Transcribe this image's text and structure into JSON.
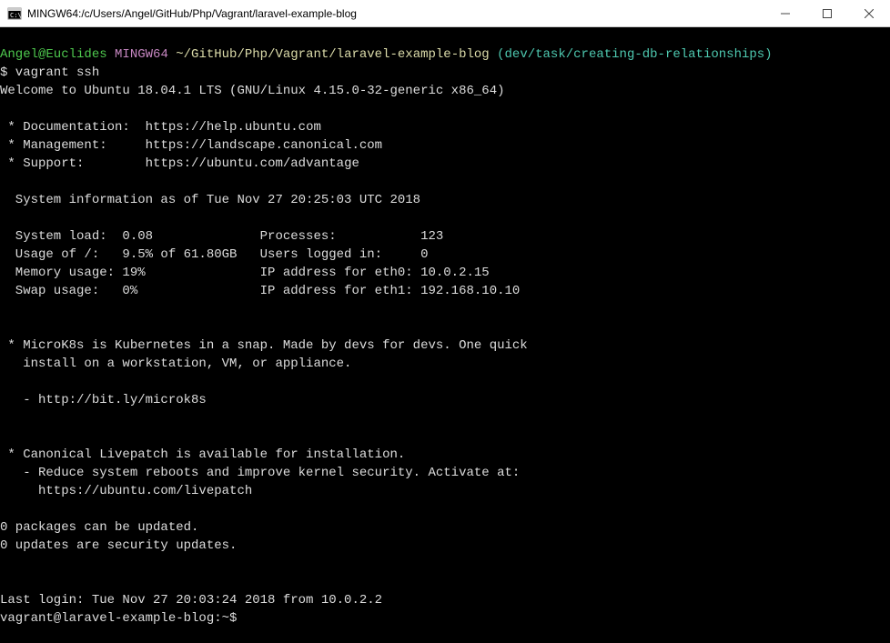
{
  "window": {
    "title": "MINGW64:/c/Users/Angel/GitHub/Php/Vagrant/laravel-example-blog"
  },
  "prompt": {
    "user": "Angel@Euclides",
    "shell": "MINGW64",
    "path": "~/GitHub/Php/Vagrant/laravel-example-blog",
    "branch": "(dev/task/creating-db-relationships)",
    "command": "$ vagrant ssh"
  },
  "welcome": "Welcome to Ubuntu 18.04.1 LTS (GNU/Linux 4.15.0-32-generic x86_64)",
  "links": {
    "doc_label": " * Documentation:  ",
    "doc_url": "https://help.ubuntu.com",
    "mgmt_label": " * Management:     ",
    "mgmt_url": "https://landscape.canonical.com",
    "support_label": " * Support:        ",
    "support_url": "https://ubuntu.com/advantage"
  },
  "sysinfo": {
    "header": "  System information as of Tue Nov 27 20:25:03 UTC 2018",
    "line1": "  System load:  0.08              Processes:           123",
    "line2": "  Usage of /:   9.5% of 61.80GB   Users logged in:     0",
    "line3": "  Memory usage: 19%               IP address for eth0: 10.0.2.15",
    "line4": "  Swap usage:   0%                IP address for eth1: 192.168.10.10"
  },
  "microk8s": {
    "line1": " * MicroK8s is Kubernetes in a snap. Made by devs for devs. One quick",
    "line2": "   install on a workstation, VM, or appliance.",
    "url": "   - http://bit.ly/microk8s"
  },
  "livepatch": {
    "line1": " * Canonical Livepatch is available for installation.",
    "line2": "   - Reduce system reboots and improve kernel security. Activate at:",
    "url": "     https://ubuntu.com/livepatch"
  },
  "updates": {
    "line1": "0 packages can be updated.",
    "line2": "0 updates are security updates."
  },
  "lastlogin": "Last login: Tue Nov 27 20:03:24 2018 from 10.0.2.2",
  "shellprompt": "vagrant@laravel-example-blog:~$"
}
